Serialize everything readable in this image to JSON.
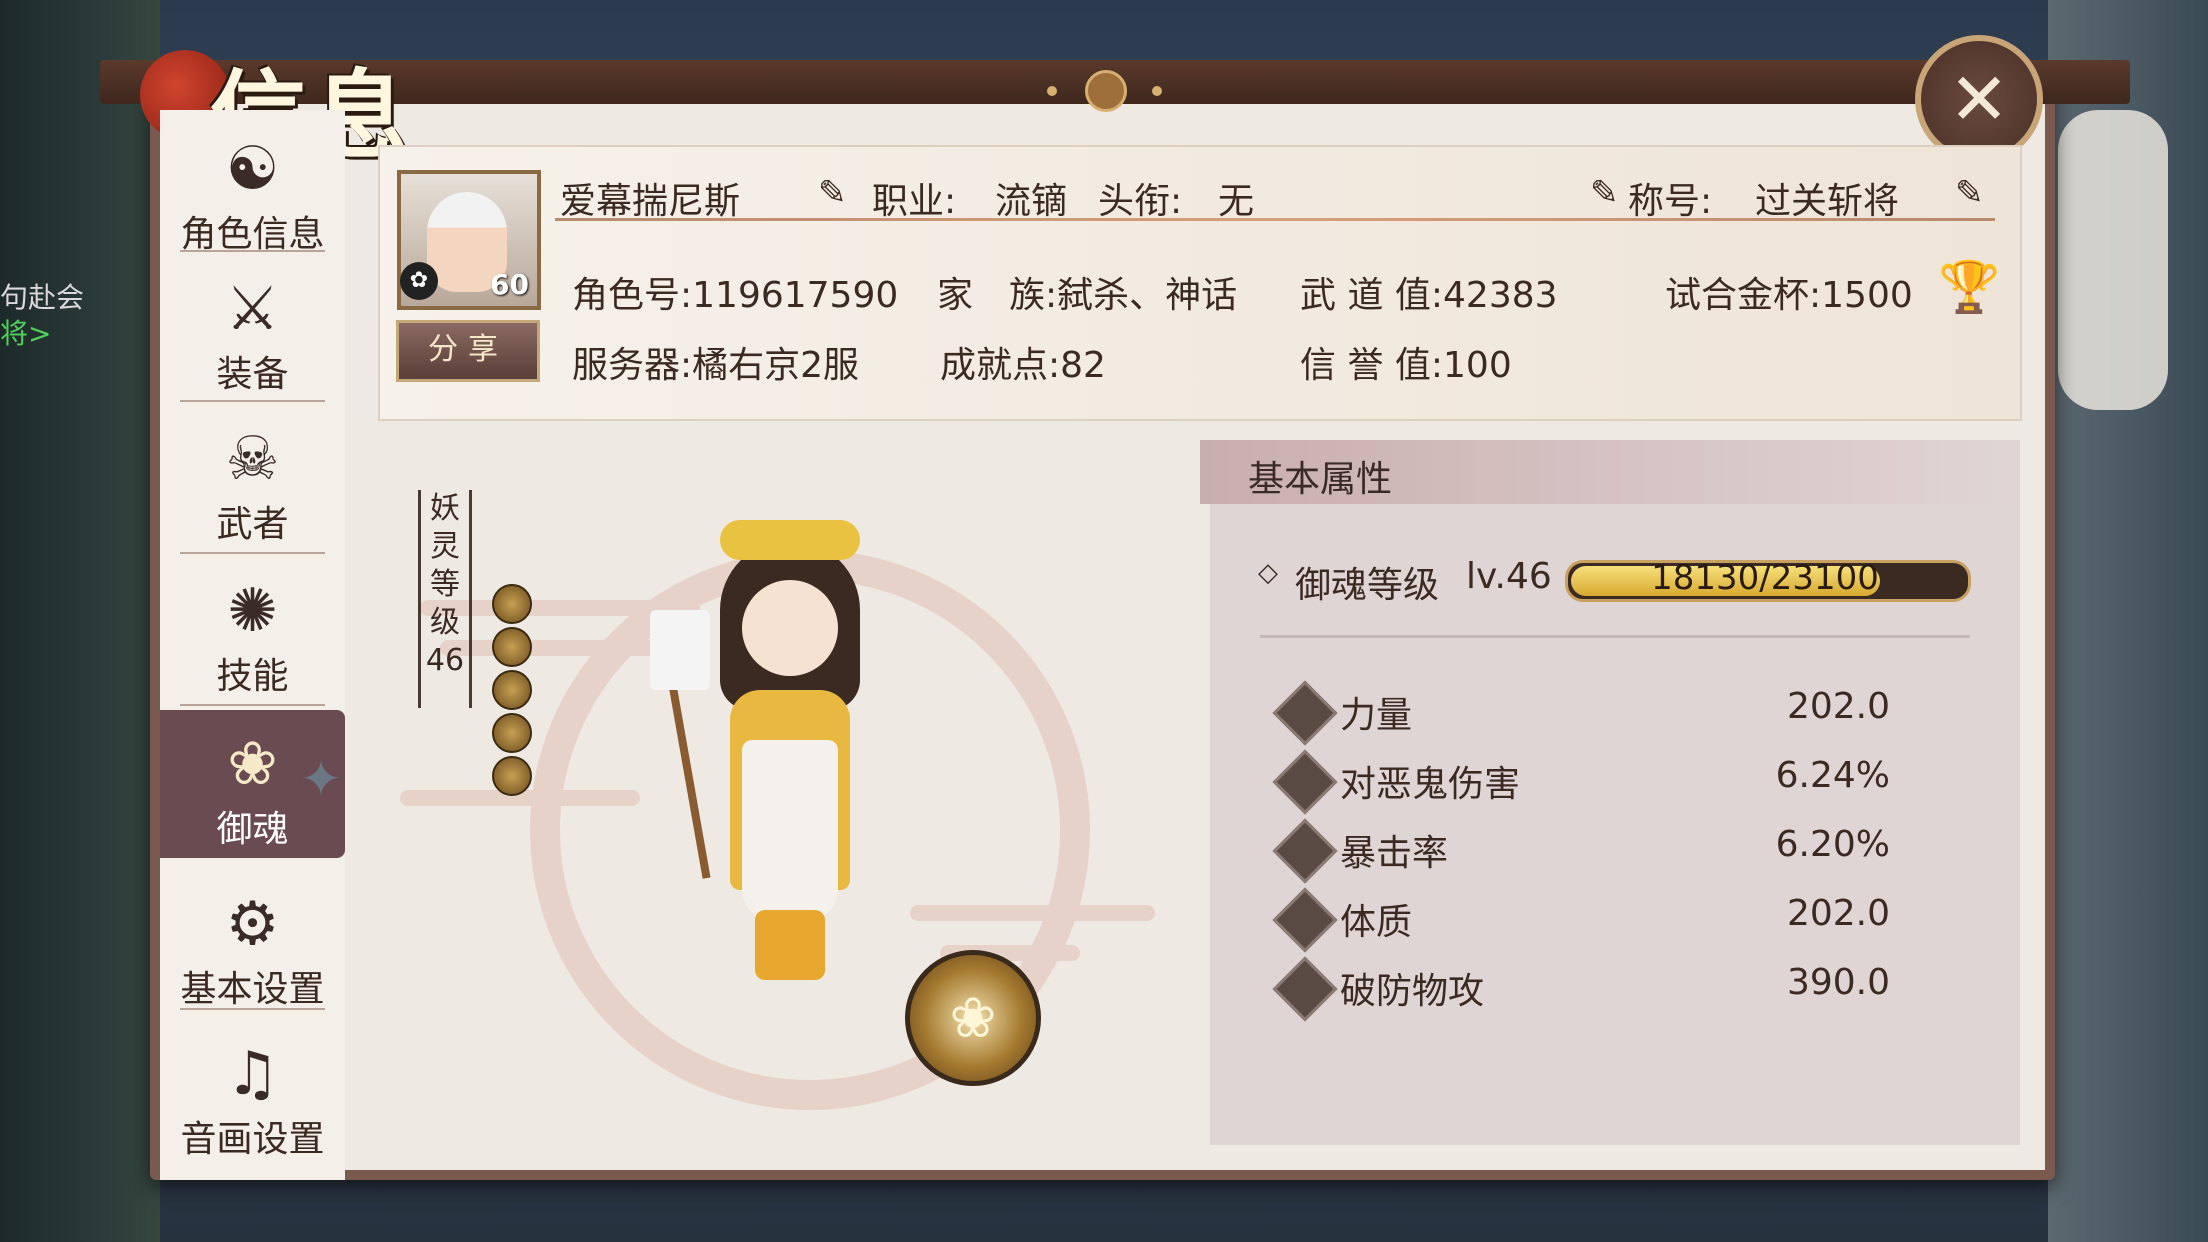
{
  "window": {
    "title": "信息",
    "close_label": "✕"
  },
  "background": {
    "chat_line1": "句赴会",
    "chat_line2": "将>"
  },
  "sidebar": {
    "items": [
      {
        "label": "角色信息",
        "icon": "character-info-icon"
      },
      {
        "label": "装备",
        "icon": "equipment-icon"
      },
      {
        "label": "武者",
        "icon": "warrior-icon"
      },
      {
        "label": "技能",
        "icon": "skill-icon"
      },
      {
        "label": "御魂",
        "icon": "spirit-icon",
        "active": true
      },
      {
        "label": "基本设置",
        "icon": "gear-icon"
      },
      {
        "label": "音画设置",
        "icon": "audio-video-icon"
      }
    ]
  },
  "profile": {
    "name": "爱幕揣尼斯",
    "level": "60",
    "job_label": "职业:",
    "job_value": "流镝",
    "rank_label": "头衔:",
    "rank_value": "无",
    "title_label": "称号:",
    "title_value": "过关斩将",
    "role_id": "角色号:119617590",
    "family": "家　族:弑杀、神话",
    "wudao": "武 道 值:42383",
    "trial_cup": "试合金杯:1500",
    "server": "服务器:橘右京2服",
    "achievement": "成就点:82",
    "reputation": "信 誉 值:100",
    "share_label": "分享"
  },
  "spirit": {
    "type_label": "妖灵",
    "level_label": "等级",
    "level_value": "46",
    "star_count": 5
  },
  "attributes": {
    "header": "基本属性",
    "yuhun_level_label": "御魂等级",
    "yuhun_level": "lv.46",
    "exp_text": "18130/23100",
    "exp_current": 18130,
    "exp_max": 23100,
    "rows": [
      {
        "name": "力量",
        "value": "202.0"
      },
      {
        "name": "对恶鬼伤害",
        "value": "6.24%"
      },
      {
        "name": "暴击率",
        "value": "6.20%"
      },
      {
        "name": "体质",
        "value": "202.0"
      },
      {
        "name": "破防物攻",
        "value": "390.0"
      }
    ]
  },
  "colors": {
    "accent": "#6a4b52",
    "panel": "#efe9e3",
    "gold": "#d8a830"
  }
}
